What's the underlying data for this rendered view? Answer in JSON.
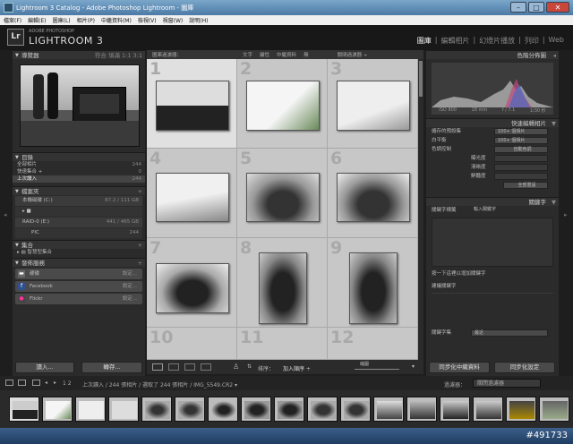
{
  "window": {
    "title": "Lightroom 3 Catalog - Adobe Photoshop Lightroom - 圖庫",
    "min": "–",
    "max": "□",
    "close": "✕"
  },
  "menu": [
    "檔案(F)",
    "編輯(E)",
    "圖庫(L)",
    "相片(P)",
    "中繼資料(M)",
    "檢視(V)",
    "視窗(W)",
    "說明(H)"
  ],
  "brand": {
    "logo": "Lr",
    "line1": "ADOBE PHOTOSHOP",
    "line2": "LIGHTROOM 3"
  },
  "modules": [
    "圖庫",
    "編輯相片",
    "幻燈片播放",
    "列印",
    "Web"
  ],
  "left": {
    "navigator": {
      "title": "導覽器",
      "zoom": "符合  填滿  1:1  3:1"
    },
    "catalog": {
      "title": "目錄",
      "items": [
        {
          "label": "全部相片",
          "count": "244"
        },
        {
          "label": "快速集合 +",
          "count": "0"
        },
        {
          "label": "上次讀入",
          "count": "244"
        }
      ]
    },
    "folders": {
      "title": "檔案夾",
      "plus": "+",
      "rows": [
        {
          "label": "本機磁碟 (C:)",
          "count": "87.2 / 111 GB"
        },
        {
          "label": "",
          "count": ""
        },
        {
          "label": "RAID-0 (E:)",
          "count": "441 / 465 GB"
        },
        {
          "label": "PIC",
          "count": "244"
        }
      ]
    },
    "collections": {
      "title": "集合",
      "plus": "+",
      "items": [
        {
          "label": "智慧型集合"
        }
      ]
    },
    "publish": {
      "title": "發佈服務",
      "plus": "+",
      "items": [
        {
          "label": "硬碟",
          "action": "設定..."
        },
        {
          "label": "Facebook",
          "action": "設定..."
        },
        {
          "label": "Flickr",
          "action": "設定..."
        }
      ]
    },
    "import_button": "讀入...",
    "export_button": "轉存..."
  },
  "grid": {
    "filter_label": "圖庫過濾器：",
    "filter_tabs": [
      "文字",
      "屬性",
      "中繼資料",
      "無"
    ],
    "filter_off": "關閉過濾器 ÷",
    "cell_numbers": [
      "1",
      "2",
      "3",
      "4",
      "5",
      "6",
      "7",
      "8",
      "9",
      "10",
      "11",
      "12"
    ],
    "sort_label": "排序：",
    "sort_value": "加入順序 ÷",
    "thumbs_label": "縮圖"
  },
  "right": {
    "histogram": {
      "title": "色階分佈圖",
      "iso": "ISO 800",
      "focal": "18 mm",
      "aperture": "f / 7.1",
      "shutter": "1/30 秒"
    },
    "quick_develop": {
      "title": "快速編輯相片",
      "rows": [
        {
          "label": "儲存的預設集",
          "value": "100+ 個相片"
        },
        {
          "label": "白平衡",
          "value": "100+ 個相片"
        },
        {
          "label": "色調控制",
          "value": "自動色調"
        },
        {
          "label": "曝光度",
          "value": ""
        },
        {
          "label": "清晰度",
          "value": ""
        },
        {
          "label": "鮮豔度",
          "value": ""
        }
      ],
      "reset": "全部重設"
    },
    "keywording": {
      "title": "關鍵字",
      "tags_label": "關鍵字標籤",
      "tags_value": "輸入關鍵字",
      "hint": "按一下這裡以增加關鍵字",
      "suggest": "建議關鍵字"
    },
    "keyword_set": {
      "label": "關鍵字集",
      "value": "最近"
    },
    "sync_meta": "同步化中繼資料",
    "sync_settings": "同步化設定"
  },
  "filmstrip": {
    "pages": "1  2",
    "source": "上次讀入 / 244 張相片 / 選取了 244 張相片 / IMG_5549.CR2 ▾",
    "filter": "過濾器：",
    "filter_value": "關閉過濾器"
  },
  "watermark": "#491733"
}
